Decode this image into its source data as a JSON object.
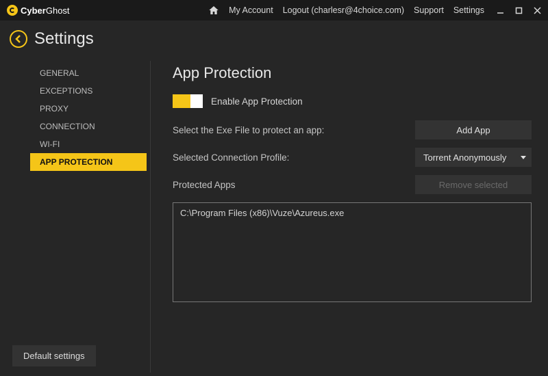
{
  "topbar": {
    "brand": {
      "prefix": "Cyber",
      "suffix": "Ghost"
    },
    "links": {
      "my_account": "My Account",
      "logout": "Logout (charlesr@4choice.com)",
      "support": "Support",
      "settings": "Settings"
    }
  },
  "header": {
    "title": "Settings"
  },
  "sidebar": {
    "items": [
      {
        "label": "GENERAL",
        "active": false
      },
      {
        "label": "EXCEPTIONS",
        "active": false
      },
      {
        "label": "PROXY",
        "active": false
      },
      {
        "label": "CONNECTION",
        "active": false
      },
      {
        "label": "WI-FI",
        "active": false
      },
      {
        "label": "APP PROTECTION",
        "active": true
      }
    ],
    "default_btn": "Default settings"
  },
  "content": {
    "section_title": "App Protection",
    "toggle_label": "Enable App Protection",
    "toggle_on": true,
    "select_file_label": "Select the Exe File to protect an app:",
    "add_app_btn": "Add App",
    "profile_label": "Selected Connection Profile:",
    "profile_value": "Torrent Anonymously",
    "protected_label": "Protected Apps",
    "remove_btn": "Remove selected",
    "apps": [
      "C:\\Program Files (x86)\\Vuze\\Azureus.exe"
    ]
  }
}
